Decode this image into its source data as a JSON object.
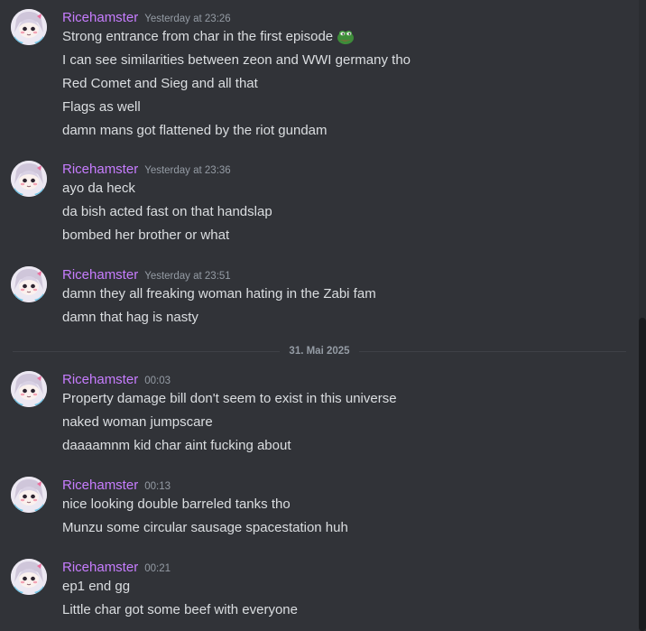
{
  "colors": {
    "background": "#313338",
    "username": "#c77dff",
    "message_text": "#dbdee1",
    "timestamp": "#949ba4",
    "divider": "#3f4147"
  },
  "groups": [
    {
      "username": "Ricehamster",
      "timestamp": "Yesterday at 23:26",
      "avatar_icon": "anime-girl-avatar-icon",
      "messages": [
        "Strong entrance from char in the first episode",
        "I can see similarities between zeon and WWI germany tho",
        "Red Comet and Sieg and all that",
        "Flags as well",
        "damn mans got flattened by the riot gundam"
      ],
      "emoji": "pepe-frog-icon"
    },
    {
      "username": "Ricehamster",
      "timestamp": "Yesterday at 23:36",
      "avatar_icon": "anime-girl-avatar-icon",
      "messages": [
        "ayo da heck",
        "da bish acted fast on that handslap",
        "bombed her brother or what"
      ]
    },
    {
      "username": "Ricehamster",
      "timestamp": "Yesterday at 23:51",
      "avatar_icon": "anime-girl-avatar-icon",
      "messages": [
        "damn they all freaking woman hating in the Zabi fam",
        "damn that hag is nasty"
      ]
    },
    {
      "username": "Ricehamster",
      "timestamp": "00:03",
      "avatar_icon": "anime-girl-avatar-icon",
      "messages": [
        "Property damage bill don't seem to exist in this universe",
        "naked woman jumpscare",
        "daaaamnm kid char aint fucking about"
      ]
    },
    {
      "username": "Ricehamster",
      "timestamp": "00:13",
      "avatar_icon": "anime-girl-avatar-icon",
      "messages": [
        "nice looking double barreled tanks tho",
        "Munzu some circular sausage spacestation huh"
      ]
    },
    {
      "username": "Ricehamster",
      "timestamp": "00:21",
      "avatar_icon": "anime-girl-avatar-icon",
      "messages": [
        "ep1 end gg",
        "Little char got some beef with everyone"
      ]
    }
  ],
  "date_divider": "31. Mai 2025"
}
